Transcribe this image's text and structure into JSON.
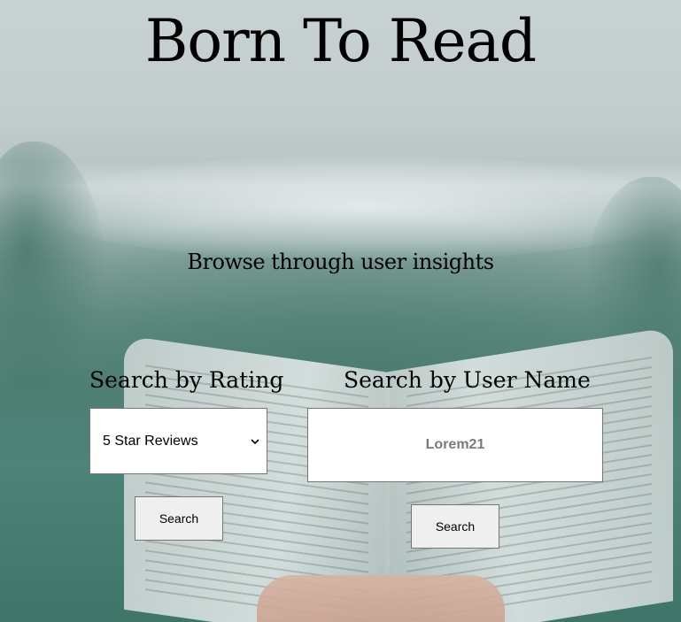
{
  "header": {
    "title": "Born To Read",
    "subtitle": "Browse through user insights"
  },
  "rating_search": {
    "label": "Search by Rating",
    "selected_option": "5 Star Reviews",
    "button_label": "Search"
  },
  "user_search": {
    "label": "Search by User Name",
    "placeholder": "Lorem21",
    "button_label": "Search"
  },
  "icons": {
    "select_chevron": "chevron-down-icon"
  }
}
